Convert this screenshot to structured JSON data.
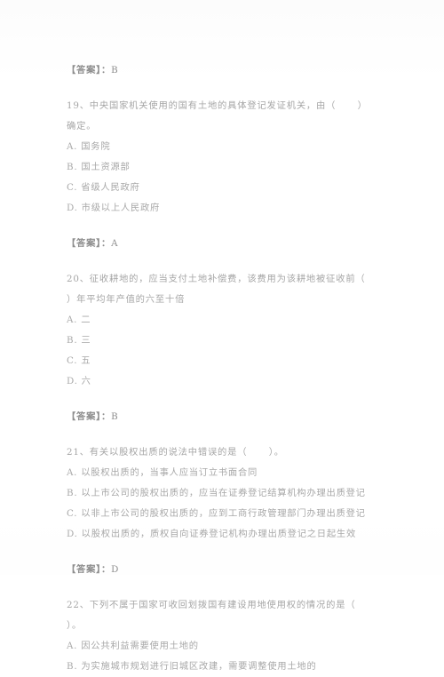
{
  "document": {
    "type": "scanned-exam-paper",
    "language": "zh-CN",
    "answer_label": "【答案】：",
    "blocks": [
      {
        "kind": "answer",
        "label": "【答案】：",
        "value": "B"
      },
      {
        "kind": "question",
        "number": "19",
        "stem_lines": [
          "19、中央国家机关使用的国有土地的具体登记发证机关，由（      ）",
          "确定。"
        ],
        "options": [
          "A. 国务院",
          "B. 国土资源部",
          "C. 省级人民政府",
          "D. 市级以上人民政府"
        ]
      },
      {
        "kind": "answer",
        "label": "【答案】：",
        "value": "A"
      },
      {
        "kind": "question",
        "number": "20",
        "stem_lines": [
          "20、征收耕地的，应当支付土地补偿费，该费用为该耕地被征收前（",
          "）年平均年产值的六至十倍"
        ],
        "options": [
          "A. 二",
          "B. 三",
          "C. 五",
          "D. 六"
        ]
      },
      {
        "kind": "answer",
        "label": "【答案】：",
        "value": "B"
      },
      {
        "kind": "question",
        "number": "21",
        "stem_lines": [
          "21、有关以股权出质的说法中错误的是（      ）。"
        ],
        "options": [
          "A. 以股权出质的，当事人应当订立书面合同",
          "B. 以上市公司的股权出质的，应当在证券登记结算机构办理出质登记",
          "C. 以非上市公司的股权出质的，应到工商行政管理部门办理出质登记",
          "D. 以股权出质的，质权自向证券登记机构办理出质登记之日起生效"
        ]
      },
      {
        "kind": "answer",
        "label": "【答案】：",
        "value": "D"
      },
      {
        "kind": "question",
        "number": "22",
        "stem_lines": [
          "22、下列不属于国家可收回划拨国有建设用地使用权的情况的是（",
          "）。"
        ],
        "options": [
          "A. 因公共利益需要使用土地的",
          "B. 为实施城市规划进行旧城区改建，需要调整使用土地的"
        ]
      }
    ]
  }
}
